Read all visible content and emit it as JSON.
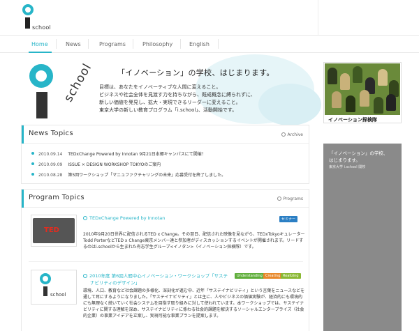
{
  "header": {
    "logo_text": "school"
  },
  "nav": {
    "items": [
      "Home",
      "News",
      "Programs",
      "Philosophy",
      "English"
    ],
    "active": "Home"
  },
  "hero": {
    "logo_text": "school",
    "title": "「イノベーション」の学校、はじまります。",
    "lines": [
      "目標は、あなたをイノベーティブな人間に変えること。",
      "ビジネスや社会全体を見渡す力を持ちながら、既成概念に縛られずに、",
      "新しい価値を発見し、拡大・実現できるリーダーに変えること。",
      "東京大学の新しい教育プログラム「i.school」、活動開始です。"
    ]
  },
  "news": {
    "title": "News Topics",
    "more": "Archive",
    "items": [
      {
        "date": "2010.09.14",
        "text": "TEDxChange Powered by Innotan 9月21日本郷キャンパスにて開催！"
      },
      {
        "date": "2010.09.09",
        "text": "ISSUE × DESIGN WORKSHOP TOKYOのご案内"
      },
      {
        "date": "2010.08.28",
        "text": "第5回ワークショップ「マニュファクチャリングの未来」応募受付を終了しました。"
      }
    ]
  },
  "programs": {
    "title": "Program Topics",
    "more": "Programs",
    "items": [
      {
        "thumb_text": "TED",
        "title": "TEDxChange Powered by Innotan",
        "tags": [
          "セミナー"
        ],
        "text": "2010年9月20日世界に配信されるTED x Change。その翌日、配信された映像を見ながら、TEDxTokyoキュレーターTodd PorterなどTED x Change東京メンバー達と参加者がディスカッションするイベントが開催されます。リードするのはi.schoolから生まれた有志学生グループ<イノタン>（イノベーション探検隊）です。"
      },
      {
        "thumb_text": "school",
        "title_line1": "2010年度 第6回人間中心イノベーション・ワークショップ「サステ",
        "title_line2": "ナビリティのデザイン」",
        "tags": [
          "Understanding",
          "Creating",
          "Realizing"
        ],
        "text": "環境、人口、教育など社会課題の多様化、深刻化が進む中、近年「サステイナビリティ」という言葉をニュースなどを通して耳にするようになりました。「サステイナビリティ」とは主に、人やビジネスの価値実験が、経済的にも環境的にも無理なく続いていく社会システムを目指す取り組みに対して使われています。本ワークショップでは、サステイナビリティに関する理解を深め、サステイナビリティに係わる社会的課題を解決するソーシャルエンタープライズ（社会的企業）の事業アイデアを立案し、実現可能な事業プランを提案します。"
      }
    ]
  },
  "sidebar": {
    "banner_label": "イノベーション探検隊",
    "gray_line1": "「イノベーション」の学校、",
    "gray_line2": "はじまります。",
    "gray_line3": "東京大学 i.school 開校"
  },
  "colors": {
    "accent": "#27b5c8",
    "tag_blue": "#2b7fc4",
    "tag_green": "#5fae3a",
    "tag_orange": "#e8882a",
    "tag_lime": "#8ab833"
  }
}
